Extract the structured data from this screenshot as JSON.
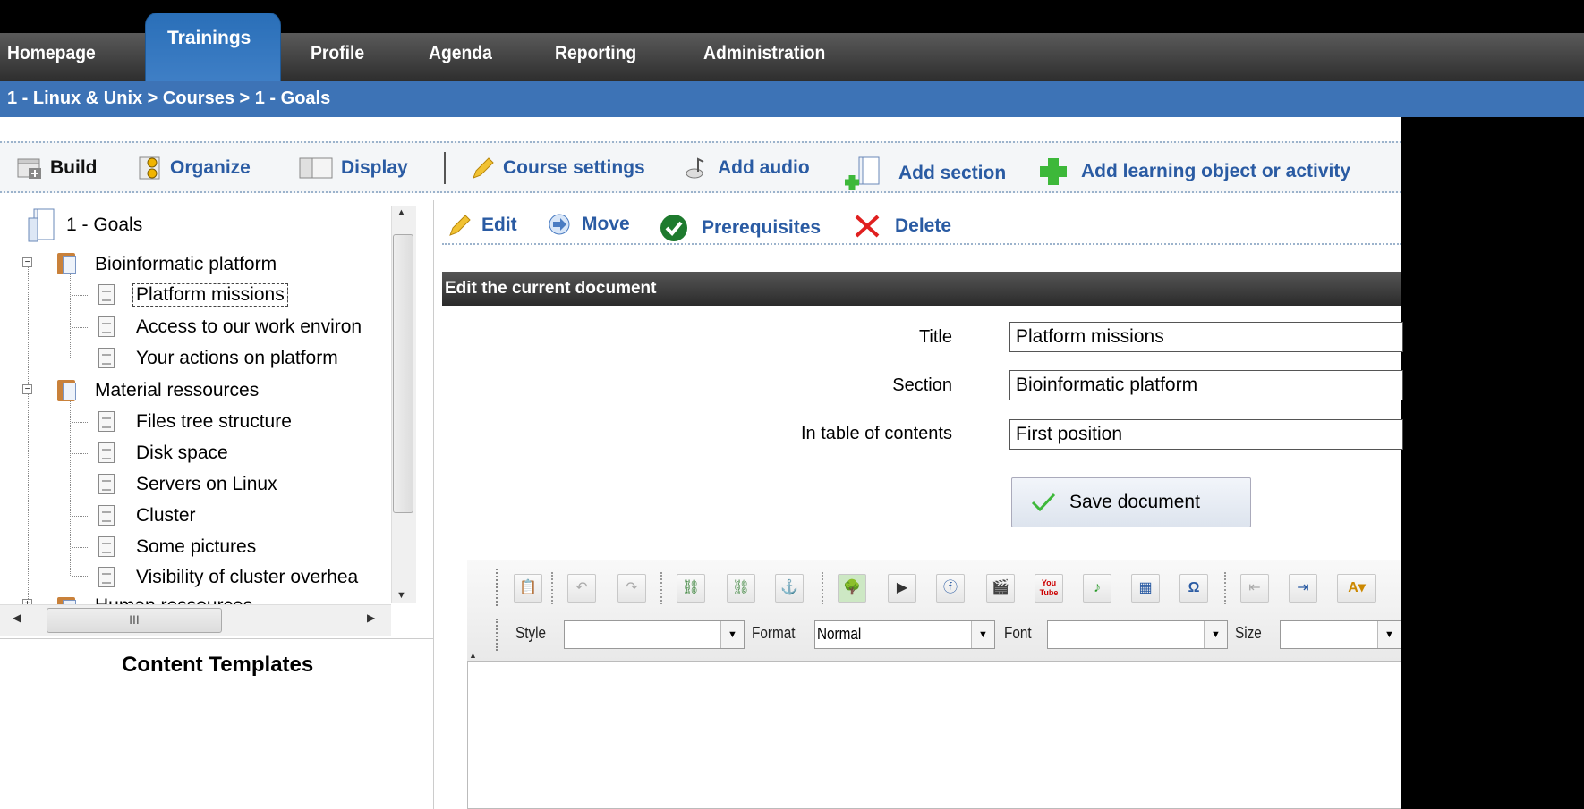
{
  "nav": {
    "tabs": [
      "Homepage",
      "Trainings",
      "Profile",
      "Agenda",
      "Reporting",
      "Administration"
    ],
    "active": "Trainings"
  },
  "breadcrumb": "1 - Linux & Unix > Courses > 1 - Goals",
  "toolbar": {
    "build": "Build",
    "organize": "Organize",
    "display": "Display",
    "course_settings": "Course settings",
    "add_audio": "Add audio",
    "add_section": "Add section",
    "add_learning": "Add learning object or activity"
  },
  "tree": {
    "root": "1 - Goals",
    "items": [
      "Bioinformatic platform",
      "Platform missions",
      "Access to our work environ",
      "Your actions on platform",
      "Material ressources",
      "Files tree structure",
      "Disk space",
      "Servers on Linux",
      "Cluster",
      "Some pictures",
      "Visibility of cluster overhea",
      "Human ressources"
    ],
    "hscroll_grip": "III"
  },
  "sidebar": {
    "templates_title": "Content Templates"
  },
  "actions": {
    "edit": "Edit",
    "move": "Move",
    "prerequisites": "Prerequisites",
    "delete": "Delete"
  },
  "form": {
    "heading": "Edit the current document",
    "title_label": "Title",
    "title_value": "Platform missions",
    "section_label": "Section",
    "section_value": "Bioinformatic platform",
    "toc_label": "In table of contents",
    "toc_value": "First position",
    "save_label": "Save document"
  },
  "editor": {
    "style_label": "Style",
    "style_value": "",
    "format_label": "Format",
    "format_value": "Normal",
    "font_label": "Font",
    "font_value": "",
    "size_label": "Size",
    "size_value": "",
    "youtube_top": "You",
    "youtube_bottom": "Tube"
  },
  "colors": {
    "nav_active": "#3d73b6",
    "link": "#2a5ba3",
    "add_green": "#3db83a",
    "delete_red": "#e02020"
  }
}
